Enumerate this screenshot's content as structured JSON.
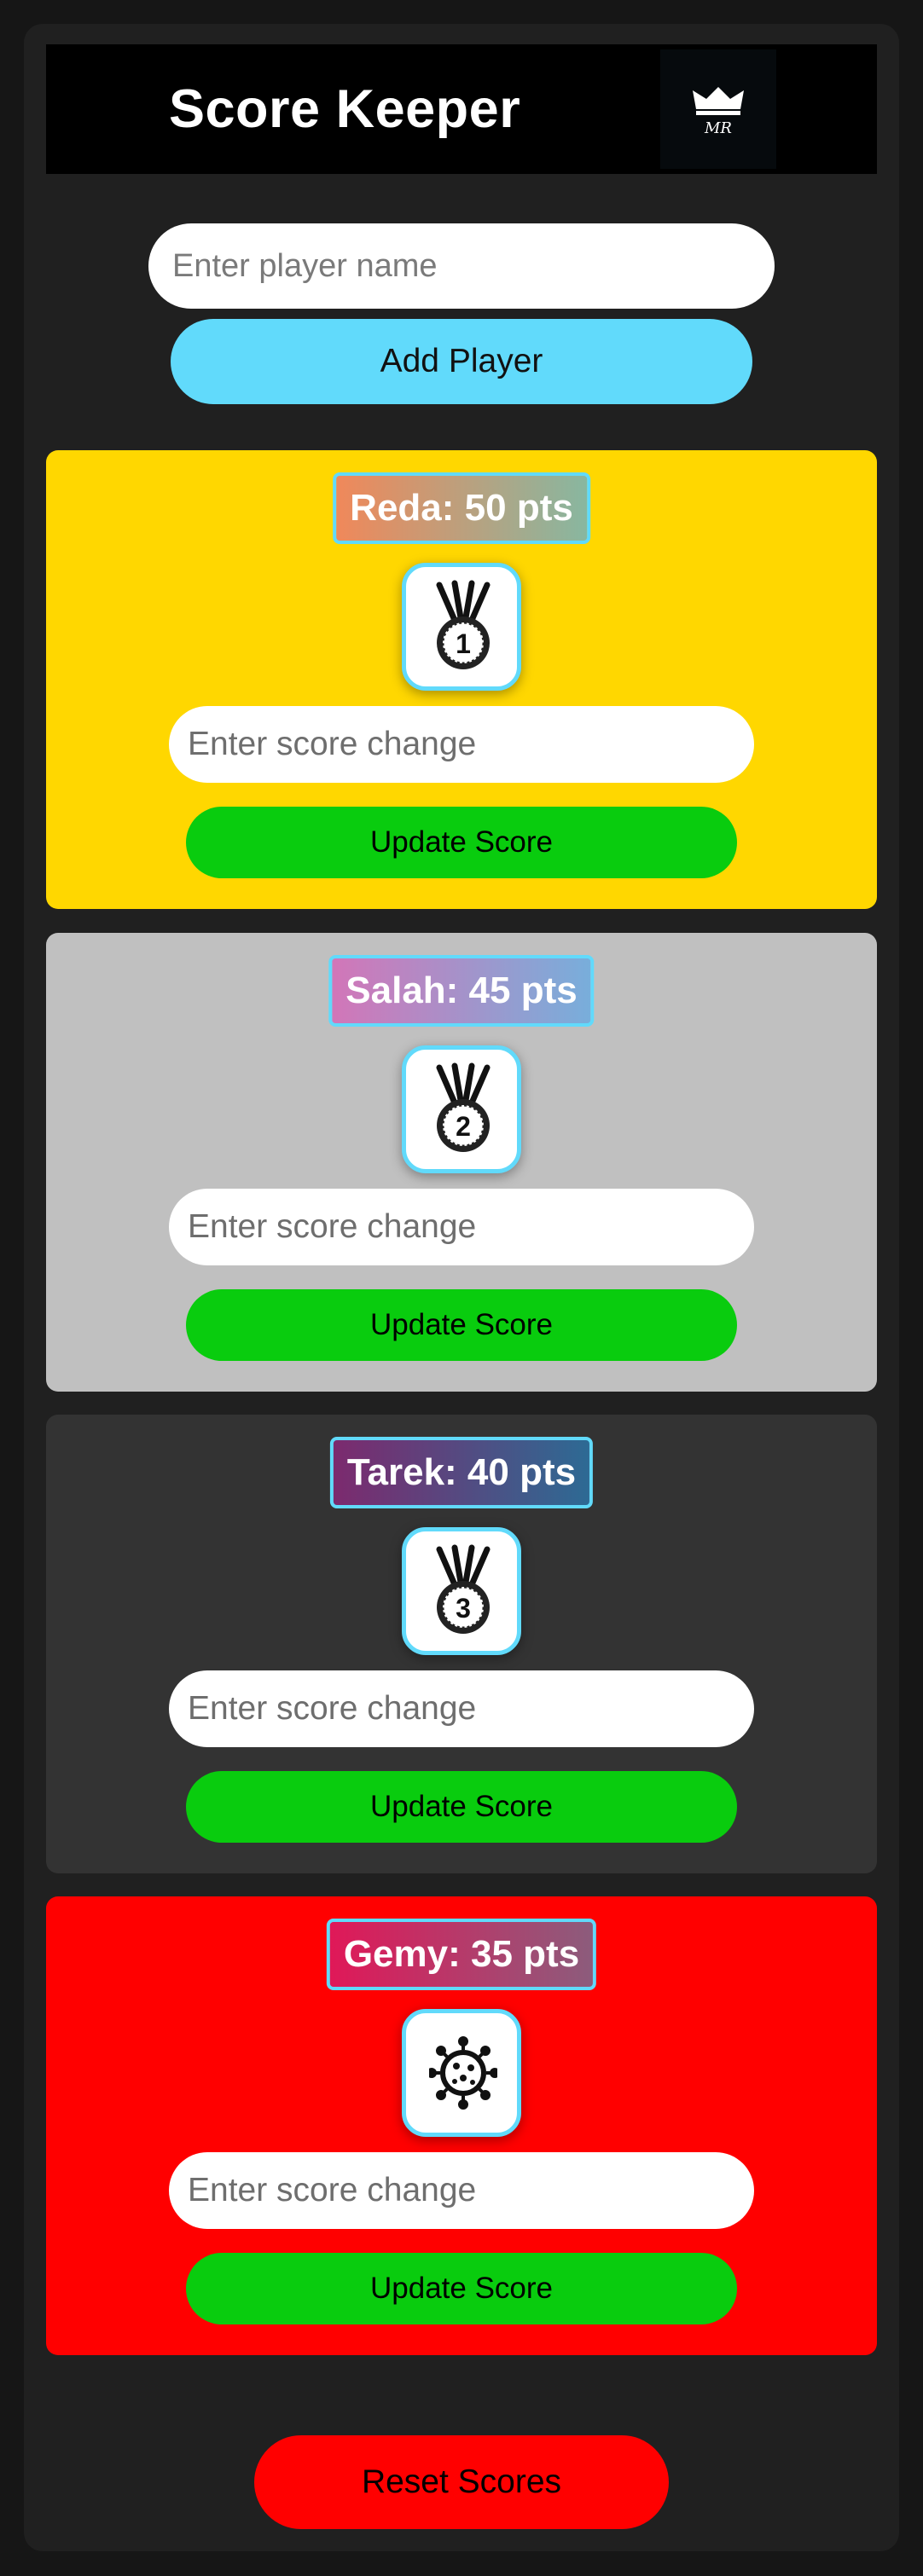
{
  "header": {
    "title": "Score Keeper",
    "logo_text": "MR"
  },
  "add_player": {
    "placeholder": "Enter player name",
    "button_label": "Add Player"
  },
  "players": [
    {
      "label": "Reda: 50 pts",
      "name": "Reda",
      "score": 50,
      "rank": "1",
      "icon": "medal-1-icon",
      "card_color": "#ffd700",
      "badge_gradient": [
        "#f0885a",
        "#88b7a0"
      ],
      "input_placeholder": "Enter score change",
      "update_label": "Update Score"
    },
    {
      "label": "Salah: 45 pts",
      "name": "Salah",
      "score": 45,
      "rank": "2",
      "icon": "medal-2-icon",
      "card_color": "#c0c0c0",
      "badge_gradient": [
        "#d276b8",
        "#78aedb"
      ],
      "input_placeholder": "Enter score change",
      "update_label": "Update Score"
    },
    {
      "label": "Tarek: 40 pts",
      "name": "Tarek",
      "score": 40,
      "rank": "3",
      "icon": "medal-3-icon",
      "card_color": "#333333",
      "badge_gradient": [
        "#7c2a6e",
        "#2d6a94"
      ],
      "input_placeholder": "Enter score change",
      "update_label": "Update Score"
    },
    {
      "label": "Gemy: 35 pts",
      "name": "Gemy",
      "score": 35,
      "rank": "",
      "icon": "virus-icon",
      "card_color": "#ff0000",
      "badge_gradient": [
        "#e01858",
        "#8c5c7c"
      ],
      "input_placeholder": "Enter score change",
      "update_label": "Update Score"
    }
  ],
  "reset": {
    "button_label": "Reset Scores"
  },
  "colors": {
    "accent": "#61dafb",
    "update_green": "#09cc0e",
    "reset_red": "#ff0000"
  }
}
